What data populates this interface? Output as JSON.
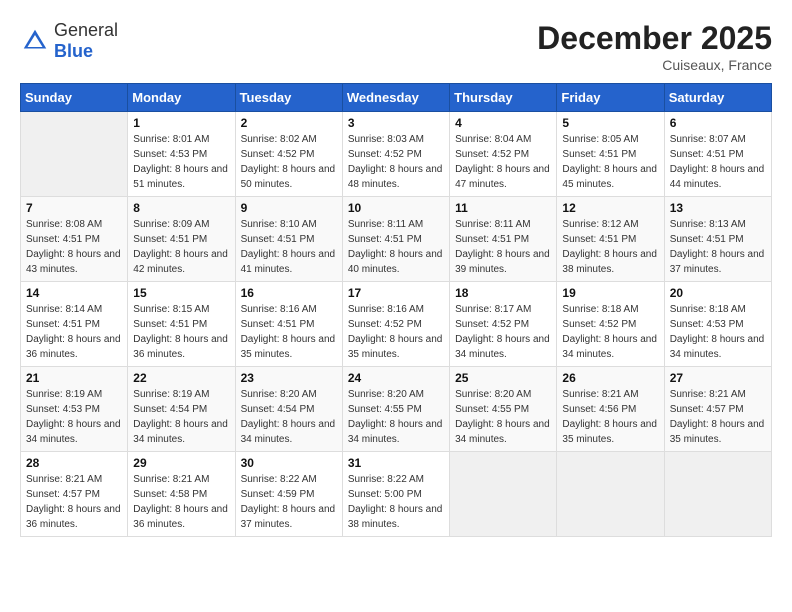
{
  "header": {
    "logo_general": "General",
    "logo_blue": "Blue",
    "month": "December 2025",
    "location": "Cuiseaux, France"
  },
  "calendar": {
    "days_of_week": [
      "Sunday",
      "Monday",
      "Tuesday",
      "Wednesday",
      "Thursday",
      "Friday",
      "Saturday"
    ],
    "weeks": [
      [
        {
          "day": "",
          "sunrise": "",
          "sunset": "",
          "daylight": ""
        },
        {
          "day": "1",
          "sunrise": "Sunrise: 8:01 AM",
          "sunset": "Sunset: 4:53 PM",
          "daylight": "Daylight: 8 hours and 51 minutes."
        },
        {
          "day": "2",
          "sunrise": "Sunrise: 8:02 AM",
          "sunset": "Sunset: 4:52 PM",
          "daylight": "Daylight: 8 hours and 50 minutes."
        },
        {
          "day": "3",
          "sunrise": "Sunrise: 8:03 AM",
          "sunset": "Sunset: 4:52 PM",
          "daylight": "Daylight: 8 hours and 48 minutes."
        },
        {
          "day": "4",
          "sunrise": "Sunrise: 8:04 AM",
          "sunset": "Sunset: 4:52 PM",
          "daylight": "Daylight: 8 hours and 47 minutes."
        },
        {
          "day": "5",
          "sunrise": "Sunrise: 8:05 AM",
          "sunset": "Sunset: 4:51 PM",
          "daylight": "Daylight: 8 hours and 45 minutes."
        },
        {
          "day": "6",
          "sunrise": "Sunrise: 8:07 AM",
          "sunset": "Sunset: 4:51 PM",
          "daylight": "Daylight: 8 hours and 44 minutes."
        }
      ],
      [
        {
          "day": "7",
          "sunrise": "Sunrise: 8:08 AM",
          "sunset": "Sunset: 4:51 PM",
          "daylight": "Daylight: 8 hours and 43 minutes."
        },
        {
          "day": "8",
          "sunrise": "Sunrise: 8:09 AM",
          "sunset": "Sunset: 4:51 PM",
          "daylight": "Daylight: 8 hours and 42 minutes."
        },
        {
          "day": "9",
          "sunrise": "Sunrise: 8:10 AM",
          "sunset": "Sunset: 4:51 PM",
          "daylight": "Daylight: 8 hours and 41 minutes."
        },
        {
          "day": "10",
          "sunrise": "Sunrise: 8:11 AM",
          "sunset": "Sunset: 4:51 PM",
          "daylight": "Daylight: 8 hours and 40 minutes."
        },
        {
          "day": "11",
          "sunrise": "Sunrise: 8:11 AM",
          "sunset": "Sunset: 4:51 PM",
          "daylight": "Daylight: 8 hours and 39 minutes."
        },
        {
          "day": "12",
          "sunrise": "Sunrise: 8:12 AM",
          "sunset": "Sunset: 4:51 PM",
          "daylight": "Daylight: 8 hours and 38 minutes."
        },
        {
          "day": "13",
          "sunrise": "Sunrise: 8:13 AM",
          "sunset": "Sunset: 4:51 PM",
          "daylight": "Daylight: 8 hours and 37 minutes."
        }
      ],
      [
        {
          "day": "14",
          "sunrise": "Sunrise: 8:14 AM",
          "sunset": "Sunset: 4:51 PM",
          "daylight": "Daylight: 8 hours and 36 minutes."
        },
        {
          "day": "15",
          "sunrise": "Sunrise: 8:15 AM",
          "sunset": "Sunset: 4:51 PM",
          "daylight": "Daylight: 8 hours and 36 minutes."
        },
        {
          "day": "16",
          "sunrise": "Sunrise: 8:16 AM",
          "sunset": "Sunset: 4:51 PM",
          "daylight": "Daylight: 8 hours and 35 minutes."
        },
        {
          "day": "17",
          "sunrise": "Sunrise: 8:16 AM",
          "sunset": "Sunset: 4:52 PM",
          "daylight": "Daylight: 8 hours and 35 minutes."
        },
        {
          "day": "18",
          "sunrise": "Sunrise: 8:17 AM",
          "sunset": "Sunset: 4:52 PM",
          "daylight": "Daylight: 8 hours and 34 minutes."
        },
        {
          "day": "19",
          "sunrise": "Sunrise: 8:18 AM",
          "sunset": "Sunset: 4:52 PM",
          "daylight": "Daylight: 8 hours and 34 minutes."
        },
        {
          "day": "20",
          "sunrise": "Sunrise: 8:18 AM",
          "sunset": "Sunset: 4:53 PM",
          "daylight": "Daylight: 8 hours and 34 minutes."
        }
      ],
      [
        {
          "day": "21",
          "sunrise": "Sunrise: 8:19 AM",
          "sunset": "Sunset: 4:53 PM",
          "daylight": "Daylight: 8 hours and 34 minutes."
        },
        {
          "day": "22",
          "sunrise": "Sunrise: 8:19 AM",
          "sunset": "Sunset: 4:54 PM",
          "daylight": "Daylight: 8 hours and 34 minutes."
        },
        {
          "day": "23",
          "sunrise": "Sunrise: 8:20 AM",
          "sunset": "Sunset: 4:54 PM",
          "daylight": "Daylight: 8 hours and 34 minutes."
        },
        {
          "day": "24",
          "sunrise": "Sunrise: 8:20 AM",
          "sunset": "Sunset: 4:55 PM",
          "daylight": "Daylight: 8 hours and 34 minutes."
        },
        {
          "day": "25",
          "sunrise": "Sunrise: 8:20 AM",
          "sunset": "Sunset: 4:55 PM",
          "daylight": "Daylight: 8 hours and 34 minutes."
        },
        {
          "day": "26",
          "sunrise": "Sunrise: 8:21 AM",
          "sunset": "Sunset: 4:56 PM",
          "daylight": "Daylight: 8 hours and 35 minutes."
        },
        {
          "day": "27",
          "sunrise": "Sunrise: 8:21 AM",
          "sunset": "Sunset: 4:57 PM",
          "daylight": "Daylight: 8 hours and 35 minutes."
        }
      ],
      [
        {
          "day": "28",
          "sunrise": "Sunrise: 8:21 AM",
          "sunset": "Sunset: 4:57 PM",
          "daylight": "Daylight: 8 hours and 36 minutes."
        },
        {
          "day": "29",
          "sunrise": "Sunrise: 8:21 AM",
          "sunset": "Sunset: 4:58 PM",
          "daylight": "Daylight: 8 hours and 36 minutes."
        },
        {
          "day": "30",
          "sunrise": "Sunrise: 8:22 AM",
          "sunset": "Sunset: 4:59 PM",
          "daylight": "Daylight: 8 hours and 37 minutes."
        },
        {
          "day": "31",
          "sunrise": "Sunrise: 8:22 AM",
          "sunset": "Sunset: 5:00 PM",
          "daylight": "Daylight: 8 hours and 38 minutes."
        },
        {
          "day": "",
          "sunrise": "",
          "sunset": "",
          "daylight": ""
        },
        {
          "day": "",
          "sunrise": "",
          "sunset": "",
          "daylight": ""
        },
        {
          "day": "",
          "sunrise": "",
          "sunset": "",
          "daylight": ""
        }
      ]
    ]
  }
}
